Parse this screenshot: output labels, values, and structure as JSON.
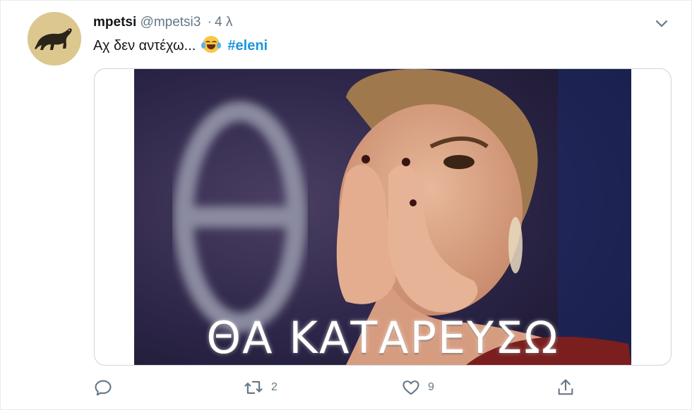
{
  "tweet": {
    "display_name": "mpetsi",
    "handle": "@mpetsi3",
    "separator": "·",
    "time": "4 λ",
    "text": "Αχ δεν αντέχω...",
    "emoji": "face-with-tears-of-joy",
    "hashtag": "#eleni",
    "media_caption": "ΘΑ ΚΑΤΑΡΕΥΣΩ"
  },
  "actions": {
    "reply_count": "",
    "retweet_count": "2",
    "like_count": "9"
  },
  "colors": {
    "link": "#1b95e0",
    "muted": "#657786",
    "border": "#ccd6dd"
  }
}
